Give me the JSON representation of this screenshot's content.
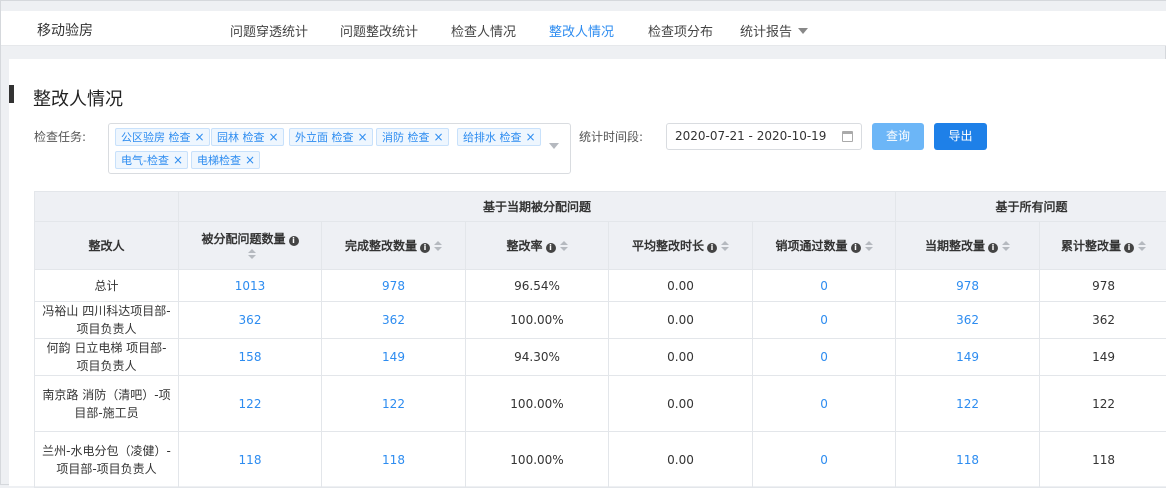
{
  "nav": {
    "brand": "移动验房",
    "items": [
      {
        "label": "问题穿透统计",
        "active": false
      },
      {
        "label": "问题整改统计",
        "active": false
      },
      {
        "label": "检查人情况",
        "active": false
      },
      {
        "label": "整改人情况",
        "active": true
      },
      {
        "label": "检查项分布",
        "active": false
      },
      {
        "label": "统计报告",
        "active": false
      }
    ]
  },
  "page": {
    "title": "整改人情况"
  },
  "filters": {
    "task_label": "检查任务:",
    "tags": [
      "公区验房 检查",
      "园林 检查",
      "外立面 检查",
      "消防 检查",
      "给排水 检查",
      "电气-检查",
      "电梯检查"
    ],
    "period_label": "统计时间段:",
    "date_range": "2020-07-21 - 2020-10-19",
    "query_button": "查询",
    "export_button": "导出"
  },
  "table": {
    "group1": "基于当期被分配问题",
    "group2": "基于所有问题",
    "columns": [
      "整改人",
      "被分配问题数量",
      "完成整改数量",
      "整改率",
      "平均整改时长",
      "销项通过数量",
      "当期整改量",
      "累计整改量"
    ],
    "rows": [
      {
        "name": "总计",
        "assigned": "1013",
        "completed": "978",
        "rate": "96.54%",
        "avg": "0.00",
        "passed": "0",
        "current": "978",
        "total": "978"
      },
      {
        "name": "冯裕山 四川科达项目部-项目负责人",
        "assigned": "362",
        "completed": "362",
        "rate": "100.00%",
        "avg": "0.00",
        "passed": "0",
        "current": "362",
        "total": "362"
      },
      {
        "name": "何韵 日立电梯 项目部-项目负责人",
        "assigned": "158",
        "completed": "149",
        "rate": "94.30%",
        "avg": "0.00",
        "passed": "0",
        "current": "149",
        "total": "149"
      },
      {
        "name": "南京路 消防（清吧）-项目部-施工员",
        "assigned": "122",
        "completed": "122",
        "rate": "100.00%",
        "avg": "0.00",
        "passed": "0",
        "current": "122",
        "total": "122"
      },
      {
        "name": "兰州-水电分包（凌健）-项目部-项目负责人",
        "assigned": "118",
        "completed": "118",
        "rate": "100.00%",
        "avg": "0.00",
        "passed": "0",
        "current": "118",
        "total": "118"
      }
    ]
  }
}
